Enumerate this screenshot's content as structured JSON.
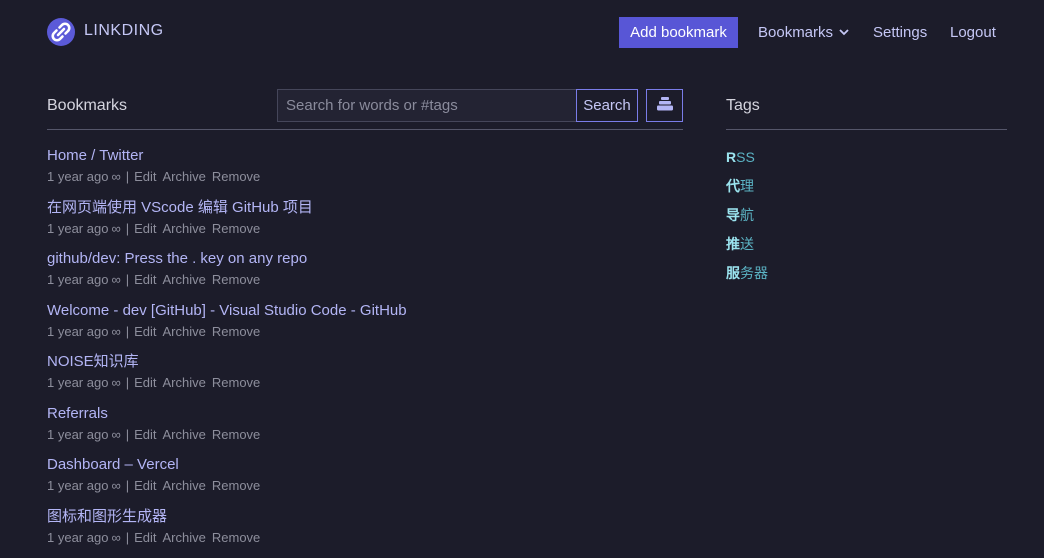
{
  "brand": {
    "name": "LINKDING"
  },
  "nav": {
    "add_bookmark": "Add bookmark",
    "bookmarks": "Bookmarks",
    "settings": "Settings",
    "logout": "Logout"
  },
  "bookmarks_section": {
    "title": "Bookmarks",
    "search_placeholder": "Search for words or #tags",
    "search_button": "Search"
  },
  "bookmarks": [
    {
      "title": "Home / Twitter",
      "age": "1 year ago",
      "shared": "∞",
      "sep": "|",
      "actions": [
        "Edit",
        "Archive",
        "Remove"
      ]
    },
    {
      "title": "在网页端使用 VScode 编辑 GitHub 项目",
      "age": "1 year ago",
      "shared": "∞",
      "sep": "|",
      "actions": [
        "Edit",
        "Archive",
        "Remove"
      ]
    },
    {
      "title": "github/dev: Press the . key on any repo",
      "age": "1 year ago",
      "shared": "∞",
      "sep": "|",
      "actions": [
        "Edit",
        "Archive",
        "Remove"
      ]
    },
    {
      "title": "Welcome - dev [GitHub] - Visual Studio Code - GitHub",
      "age": "1 year ago",
      "shared": "∞",
      "sep": "|",
      "actions": [
        "Edit",
        "Archive",
        "Remove"
      ]
    },
    {
      "title": "NOISE知识库",
      "age": "1 year ago",
      "shared": "∞",
      "sep": "|",
      "actions": [
        "Edit",
        "Archive",
        "Remove"
      ]
    },
    {
      "title": "Referrals",
      "age": "1 year ago",
      "shared": "∞",
      "sep": "|",
      "actions": [
        "Edit",
        "Archive",
        "Remove"
      ]
    },
    {
      "title": "Dashboard – Vercel",
      "age": "1 year ago",
      "shared": "∞",
      "sep": "|",
      "actions": [
        "Edit",
        "Archive",
        "Remove"
      ]
    },
    {
      "title": "图标和图形生成器",
      "age": "1 year ago",
      "shared": "∞",
      "sep": "|",
      "actions": [
        "Edit",
        "Archive",
        "Remove"
      ]
    }
  ],
  "tags_section": {
    "title": "Tags"
  },
  "tags": [
    {
      "first": "R",
      "rest": "SS"
    },
    {
      "first": "代",
      "rest": "理"
    },
    {
      "first": "导",
      "rest": "航"
    },
    {
      "first": "推",
      "rest": "送"
    },
    {
      "first": "服",
      "rest": "务器"
    }
  ],
  "colors": {
    "background": "#1c1c2a",
    "accent": "#5856d6",
    "link": "#b3b5f5",
    "tag": "#5bb3c4",
    "muted": "#8d8e9c"
  },
  "icons": {
    "logo": "linkding-logo-icon",
    "dropdown": "chevron-down-icon",
    "bulk_edit": "stack-icon"
  }
}
